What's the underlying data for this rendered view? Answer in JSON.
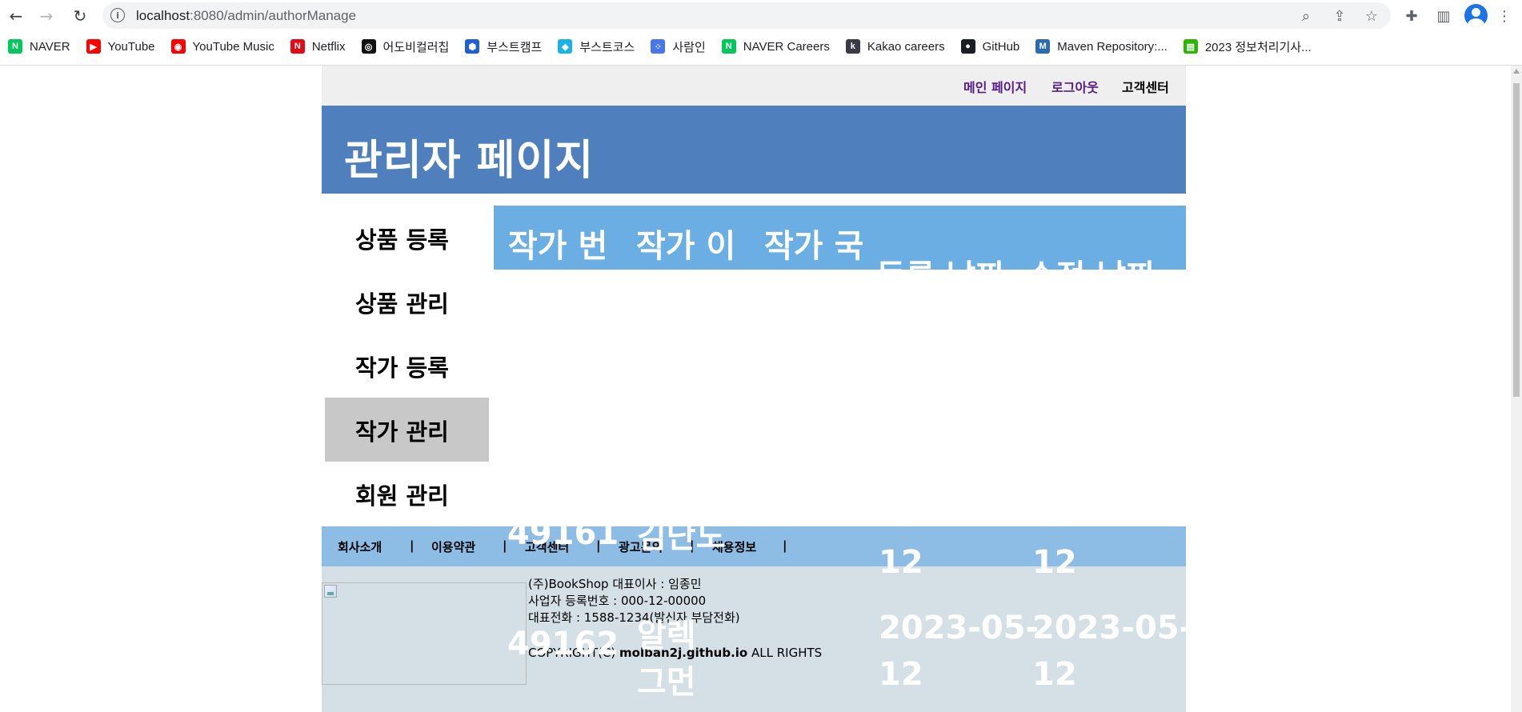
{
  "browser": {
    "url_host": "localhost",
    "url_rest": ":8080/admin/authorManage",
    "bookmarks": [
      {
        "label": "NAVER",
        "icon": "naver-icon",
        "color": "#03c75a",
        "glyph": "N"
      },
      {
        "label": "YouTube",
        "icon": "youtube-icon",
        "color": "#ff0000",
        "glyph": "▶"
      },
      {
        "label": "YouTube Music",
        "icon": "youtube-music-icon",
        "color": "#ff0000",
        "glyph": "◉"
      },
      {
        "label": "Netflix",
        "icon": "netflix-icon",
        "color": "#e50914",
        "glyph": "N"
      },
      {
        "label": "어도비컬러칩",
        "icon": "adobe-color-icon",
        "color": "#111111",
        "glyph": "◎"
      },
      {
        "label": "부스트캠프",
        "icon": "boostcamp-icon",
        "color": "#1f5fdc",
        "glyph": "⬢"
      },
      {
        "label": "부스트코스",
        "icon": "boostcourse-icon",
        "color": "#19b3ea",
        "glyph": "◆"
      },
      {
        "label": "사람인",
        "icon": "saramin-icon",
        "color": "#4876ef",
        "glyph": "⁘"
      },
      {
        "label": "NAVER Careers",
        "icon": "naver-careers-icon",
        "color": "#03c75a",
        "glyph": "N"
      },
      {
        "label": "Kakao careers",
        "icon": "kakao-careers-icon",
        "color": "#3a3a4a",
        "glyph": "k"
      },
      {
        "label": "GitHub",
        "icon": "github-icon",
        "color": "#1b1f23",
        "glyph": "●"
      },
      {
        "label": "Maven Repository:...",
        "icon": "maven-icon",
        "color": "#2b6cb0",
        "glyph": "M"
      },
      {
        "label": "2023 정보처리기사...",
        "icon": "bookmark-green-icon",
        "color": "#2db400",
        "glyph": "▤"
      }
    ]
  },
  "topbar": {
    "main_page": "메인 페이지",
    "logout": "로그아웃",
    "customer_center": "고객센터"
  },
  "header": {
    "title": "관리자 페이지"
  },
  "admin_nav": {
    "items": [
      {
        "label": "상품 등록",
        "active": false
      },
      {
        "label": "상품 관리",
        "active": false
      },
      {
        "label": "작가 등록",
        "active": false
      },
      {
        "label": "작가 관리",
        "active": true
      },
      {
        "label": "회원 관리",
        "active": false
      }
    ]
  },
  "author_table": {
    "headers": [
      "작가 번",
      "작가 이",
      "작가 국",
      "등록 날짜",
      "수정 날짜"
    ],
    "visible_fragments": {
      "row1_id": "49161",
      "row1_name": "김난도",
      "row1_reg_date_tail": "12",
      "row1_mod_date_tail": "12",
      "row2_reg_date": "2023-05-",
      "row2_mod_date": "2023-05-",
      "row2_id": "49162",
      "row2_name_top": "알렉",
      "row2_name_bottom": "그먼",
      "row2_reg_date_tail": "12",
      "row2_mod_date_tail": "12"
    }
  },
  "footer": {
    "links": [
      "회사소개",
      "이용약관",
      "고객센터",
      "광고문의",
      "채용정보"
    ],
    "separator": "|",
    "company_line1": "(주)BookShop 대표이사 : 임종민",
    "company_line2": "사업자 등록번호 : 000-12-00000",
    "company_line3": "대표전화 : 1588-1234(발신자 부담전화)",
    "copyright_prefix": "COPYRIGHT(C)",
    "copyright_site": "molban2j.github.io",
    "copyright_suffix": "ALL RIGHTS"
  }
}
